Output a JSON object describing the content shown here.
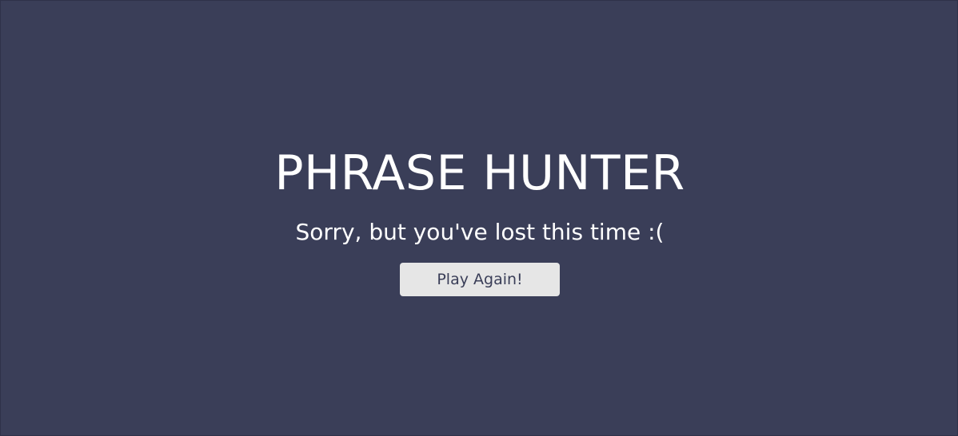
{
  "game": {
    "title": "PHRASE HUNTER",
    "message": "Sorry, but you've lost this time :(",
    "play_again_label": "Play Again!"
  },
  "colors": {
    "background": "#3a3e58",
    "text": "#ffffff",
    "button_background": "#e6e6e6",
    "button_text": "#3a3e58"
  }
}
